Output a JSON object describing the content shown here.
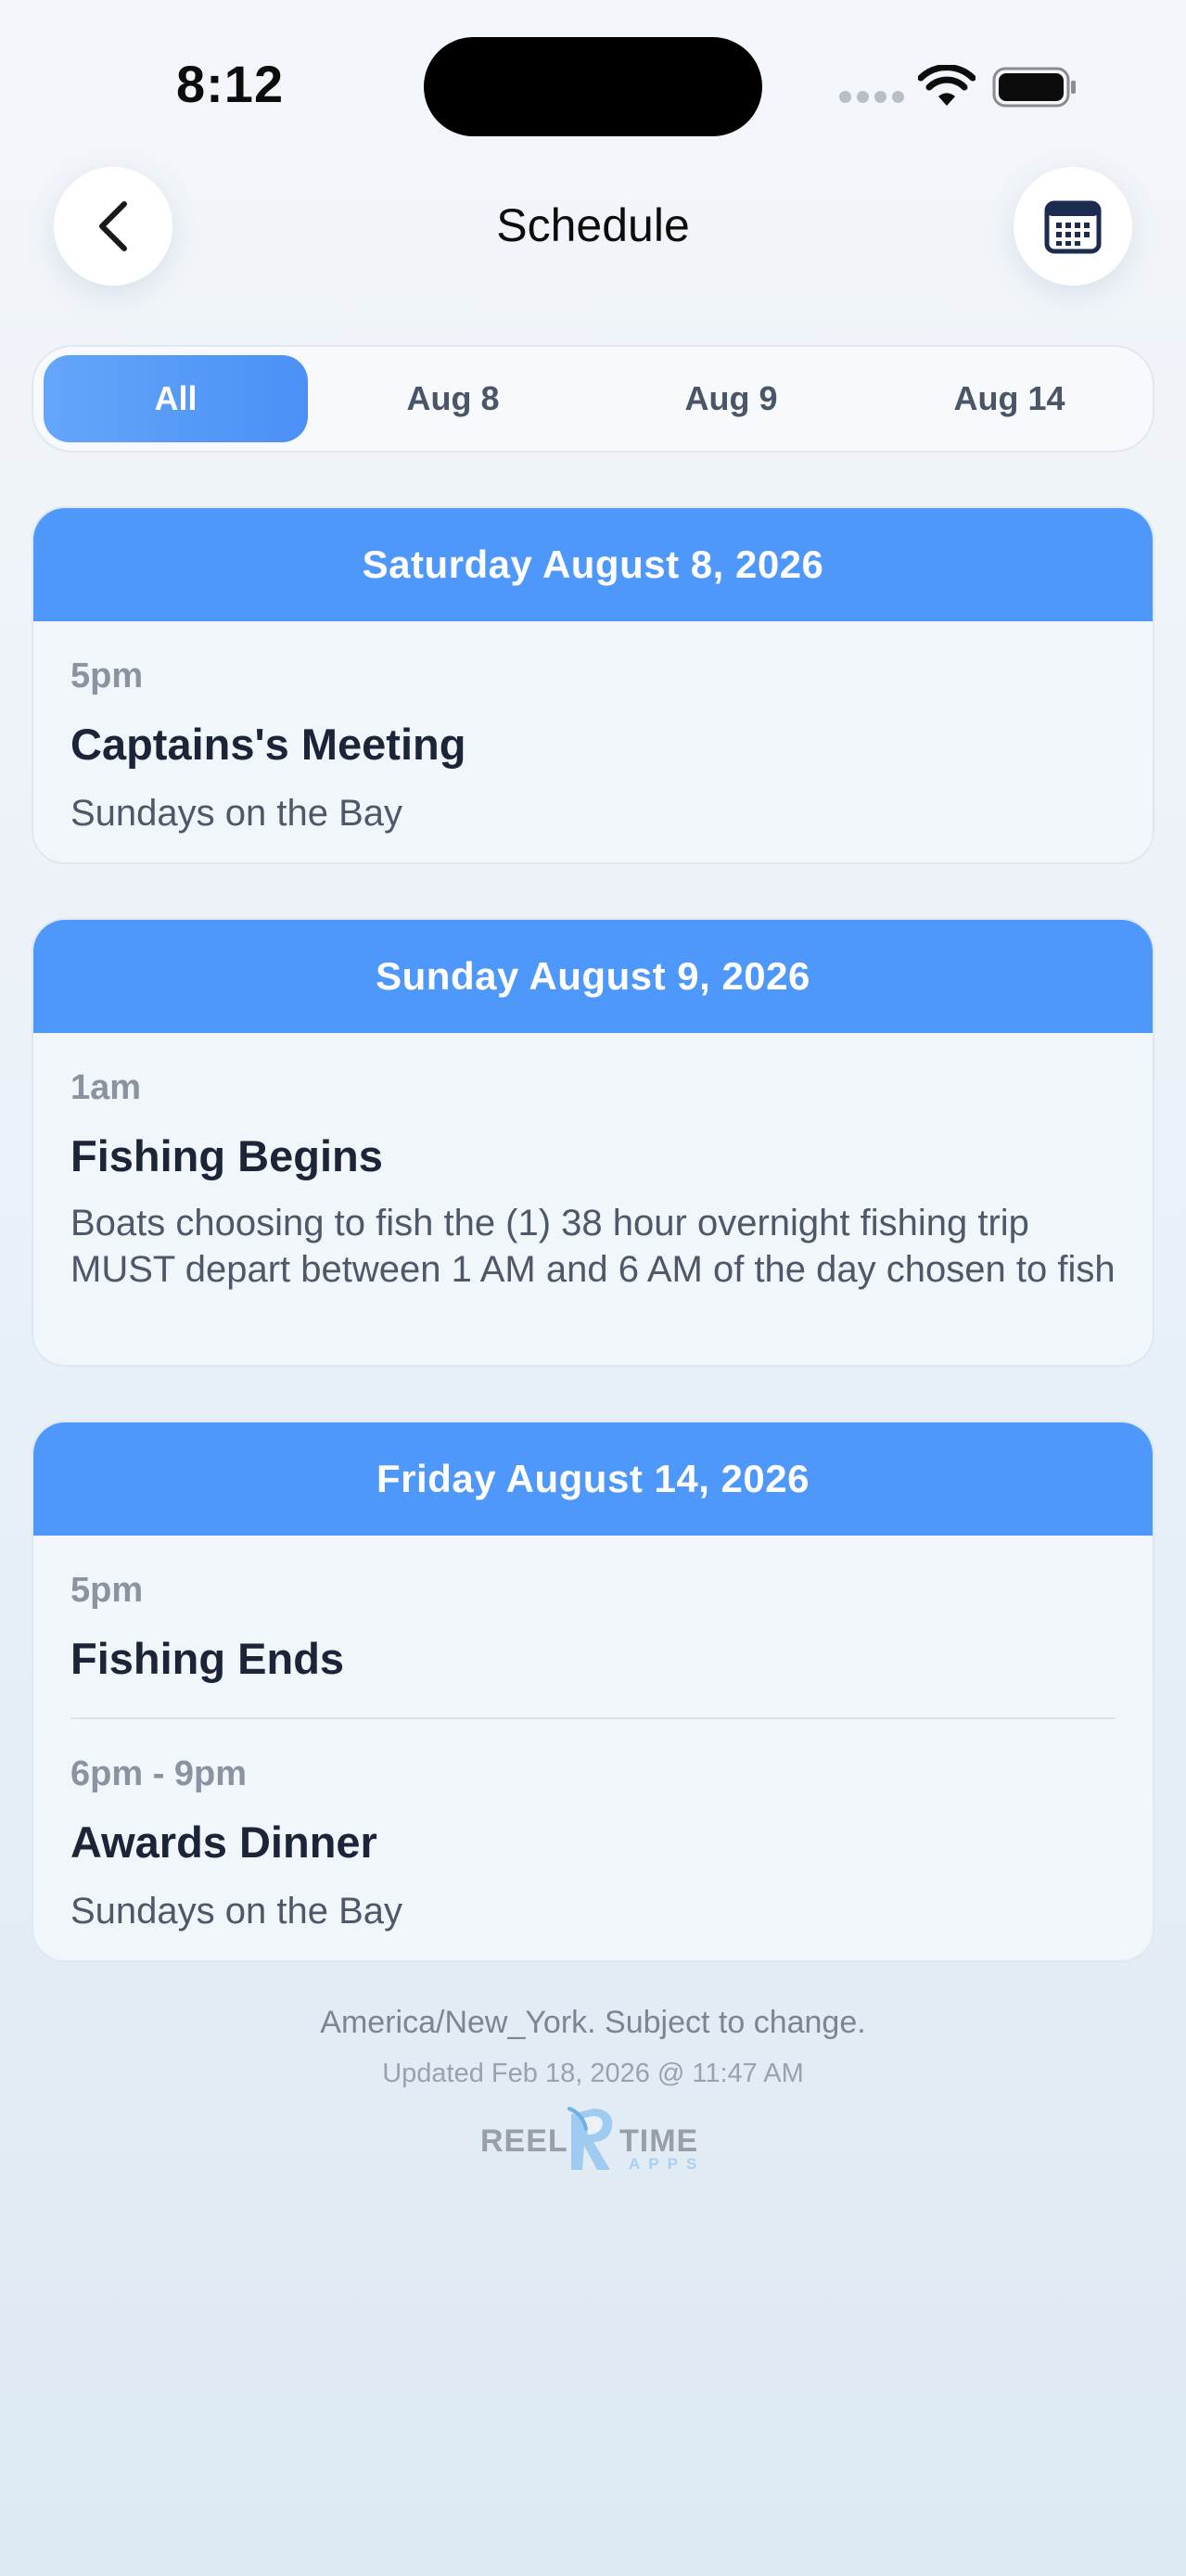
{
  "status_bar": {
    "time": "8:12"
  },
  "header": {
    "title": "Schedule"
  },
  "tabs": [
    {
      "label": "All",
      "active": true
    },
    {
      "label": "Aug 8",
      "active": false
    },
    {
      "label": "Aug 9",
      "active": false
    },
    {
      "label": "Aug 14",
      "active": false
    }
  ],
  "days": [
    {
      "date": "Saturday August 8, 2026",
      "events": [
        {
          "time": "5pm",
          "title": "Captains's Meeting",
          "desc": "Sundays on the Bay"
        }
      ]
    },
    {
      "date": "Sunday August 9, 2026",
      "events": [
        {
          "time": "1am",
          "title": "Fishing Begins",
          "desc": "Boats choosing to fish the (1) 38 hour overnight fishing trip MUST depart between 1 AM and 6 AM of the day chosen to fish"
        }
      ]
    },
    {
      "date": "Friday August 14, 2026",
      "events": [
        {
          "time": "5pm",
          "title": "Fishing Ends",
          "desc": ""
        },
        {
          "time": "6pm - 9pm",
          "title": "Awards Dinner",
          "desc": "Sundays on the Bay"
        }
      ]
    }
  ],
  "footer": {
    "timezone_note": "America/New_York. Subject to change.",
    "updated": "Updated Feb 18, 2026 @ 11:47 AM",
    "logo": {
      "left": "REEL",
      "right": "TIME",
      "sub": "APPS"
    }
  },
  "colors": {
    "accent": "#4f98fb",
    "tab_active": "#5a9cf8",
    "background": "#eaf1f8"
  },
  "icons": {
    "back": "chevron-left-icon",
    "calendar": "calendar-icon"
  }
}
